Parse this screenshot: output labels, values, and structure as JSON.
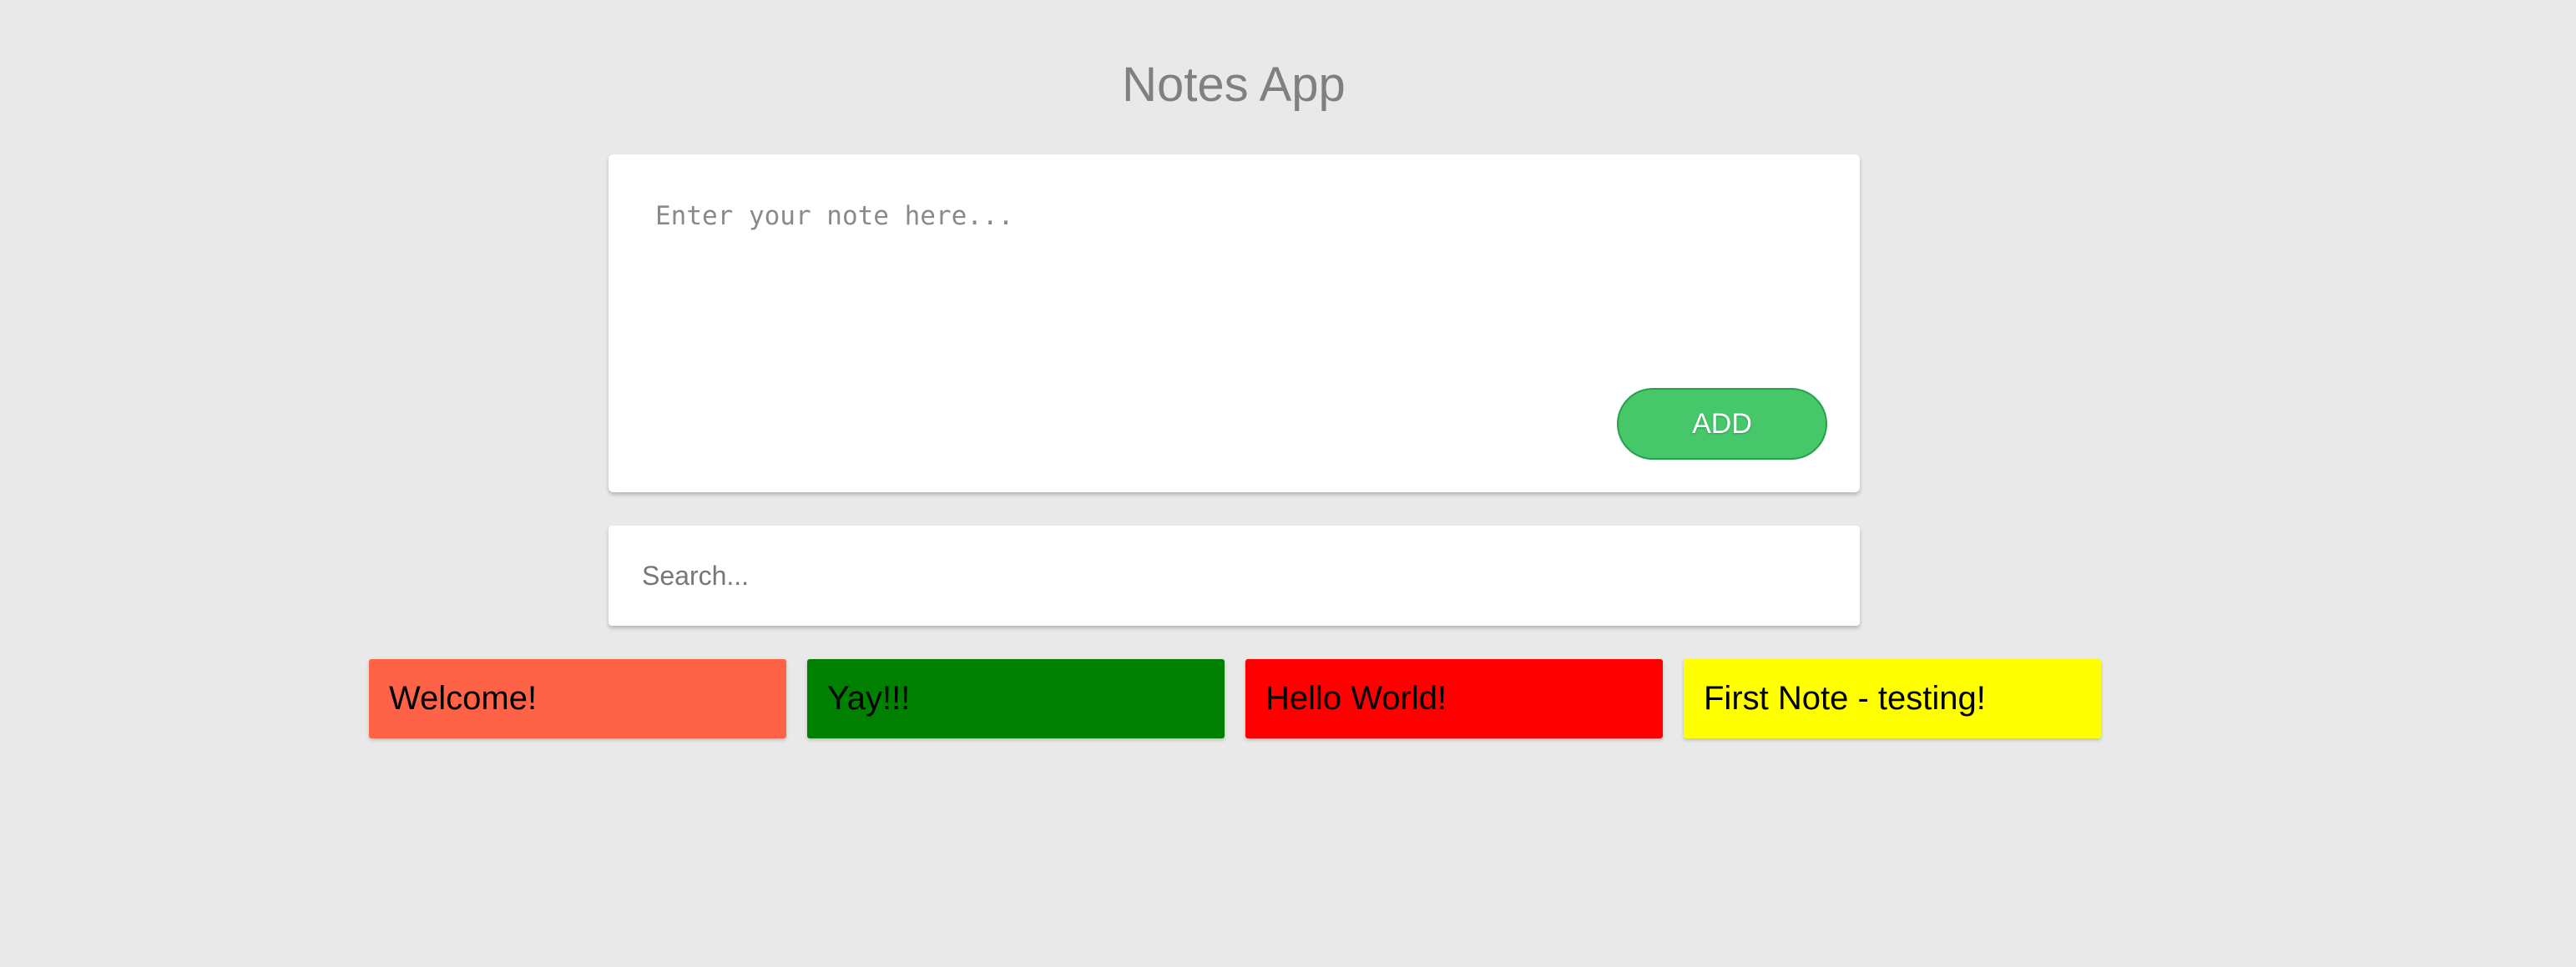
{
  "app": {
    "title": "Notes App"
  },
  "editor": {
    "placeholder": "Enter your note here...",
    "value": "",
    "add_label": "ADD",
    "colors": [
      {
        "name": "grey",
        "hex": "#888888"
      },
      {
        "name": "green",
        "hex": "#008000"
      },
      {
        "name": "tomato",
        "hex": "#ff6347"
      },
      {
        "name": "yellow",
        "hex": "#ffff00"
      },
      {
        "name": "red",
        "hex": "#ff0000"
      },
      {
        "name": "brown",
        "hex": "#a52a2a"
      }
    ]
  },
  "search": {
    "placeholder": "Search...",
    "value": ""
  },
  "notes": [
    {
      "text": "Welcome!",
      "color": "#ff6347"
    },
    {
      "text": "Yay!!!",
      "color": "#008000"
    },
    {
      "text": "Hello World!",
      "color": "#ff0000"
    },
    {
      "text": "First Note - testing!",
      "color": "#ffff00"
    }
  ]
}
